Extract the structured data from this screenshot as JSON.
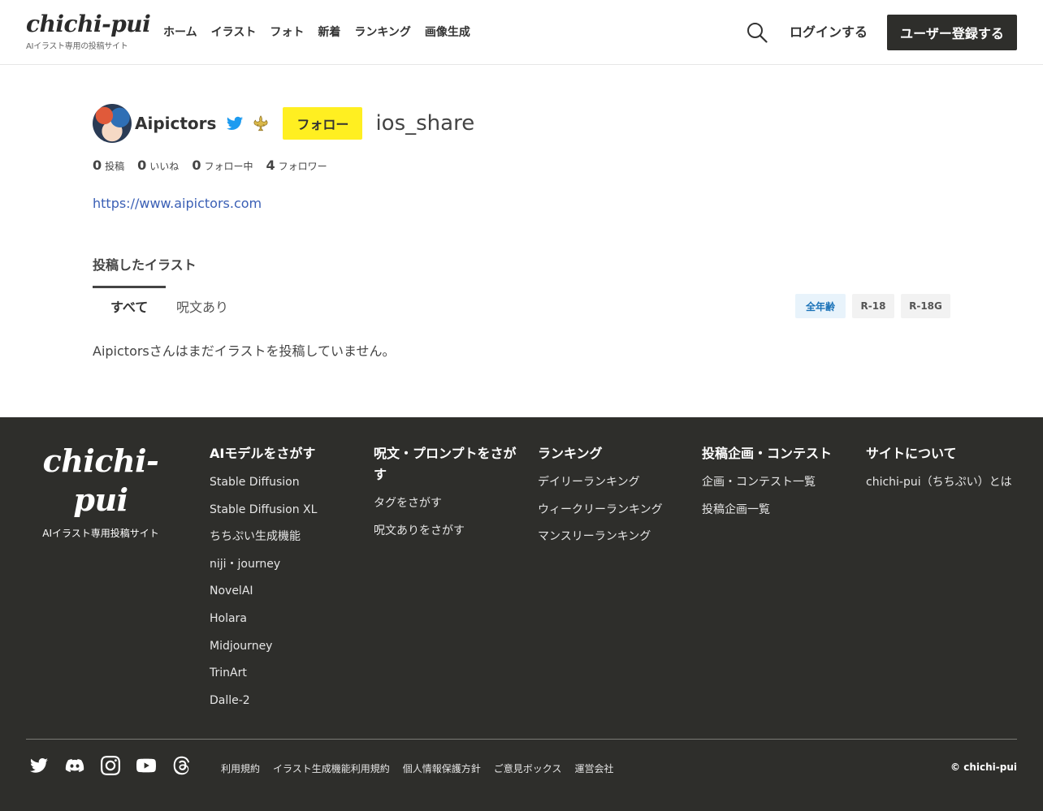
{
  "header": {
    "logo": "chichi-pui",
    "logo_sub": "AIイラスト専用の投稿サイト",
    "nav": [
      "ホーム",
      "イラスト",
      "フォト",
      "新着",
      "ランキング",
      "画像生成"
    ],
    "login": "ログインする",
    "register": "ユーザー登録する"
  },
  "profile": {
    "name": "Aipictors",
    "follow": "フォロー",
    "share": "ios_share",
    "stats": [
      {
        "num": "0",
        "label": "投稿"
      },
      {
        "num": "0",
        "label": "いいね"
      },
      {
        "num": "0",
        "label": "フォロー中"
      },
      {
        "num": "4",
        "label": "フォロワー"
      }
    ],
    "url": "https://www.aipictors.com"
  },
  "posts": {
    "title": "投稿したイラスト",
    "tab_all": "すべて",
    "tab_prompt": "呪文あり",
    "age_all": "全年齢",
    "age_r18": "R-18",
    "age_r18g": "R-18G",
    "empty": "Aipictorsさんはまだイラストを投稿していません。"
  },
  "footer": {
    "logo": "chichi-pui",
    "logo_sub": "AIイラスト専用投稿サイト",
    "columns": [
      {
        "title": "AIモデルをさがす",
        "links": [
          "Stable Diffusion",
          "Stable Diffusion XL",
          "ちちぷい生成機能",
          "niji・journey",
          "NovelAI",
          "Holara",
          "Midjourney",
          "TrinArt",
          "Dalle-2"
        ]
      },
      {
        "title": "呪文・プロンプトをさがす",
        "links": [
          "タグをさがす",
          "呪文ありをさがす"
        ]
      },
      {
        "title": "ランキング",
        "links": [
          "デイリーランキング",
          "ウィークリーランキング",
          "マンスリーランキング"
        ]
      },
      {
        "title": "投稿企画・コンテスト",
        "links": [
          "企画・コンテスト一覧",
          "投稿企画一覧"
        ]
      },
      {
        "title": "サイトについて",
        "links": [
          "chichi-pui（ちちぷい）とは"
        ]
      }
    ],
    "bottom_links": [
      "利用規約",
      "イラスト生成機能利用規約",
      "個人情報保護方針",
      "ご意見ボックス",
      "運営会社"
    ],
    "copyright": "© chichi-pui"
  },
  "colors": {
    "accent_follow": "#ffef21",
    "footer_bg": "#2e2e2b",
    "link_blue": "#3a5fb5"
  }
}
